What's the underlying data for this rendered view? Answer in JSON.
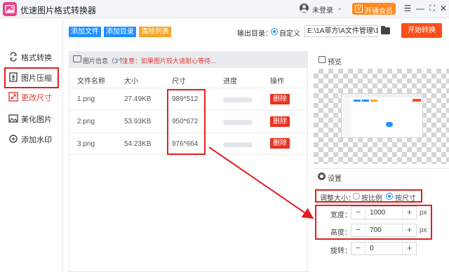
{
  "app": {
    "title": "优速图片格式转换器"
  },
  "titlebar": {
    "login_text": "未登录",
    "vip_label": "开通会员"
  },
  "sidebar": {
    "items": [
      {
        "label": "格式转换",
        "icon": "format-convert-icon"
      },
      {
        "label": "图片压缩",
        "icon": "image-compress-icon"
      },
      {
        "label": "更改尺寸",
        "icon": "resize-icon",
        "active": true
      },
      {
        "label": "美化图片",
        "icon": "beautify-icon"
      },
      {
        "label": "添加水印",
        "icon": "watermark-icon"
      }
    ]
  },
  "toolbar": {
    "add_file": "添加文件",
    "add_dir": "添加目录",
    "clear_list": "清除列表",
    "output_dir_label": "输出目录：",
    "custom_label": "自定义",
    "output_path": "E:\\1A菲方\\A文件管理\\1",
    "start_label": "开始转换"
  },
  "file_panel": {
    "info_label": "图片信息（3个）",
    "notice": "注意：如果图片较大请耐心等待...",
    "columns": [
      "文件名称",
      "大小",
      "尺寸",
      "进度",
      "操作"
    ],
    "rows": [
      {
        "name": "1.png",
        "size": "27.49KB",
        "dims": "989*512",
        "progress": 0,
        "action": "删除"
      },
      {
        "name": "2.png",
        "size": "53.93KB",
        "dims": "950*672",
        "progress": 0,
        "action": "删除"
      },
      {
        "name": "3.png",
        "size": "54.23KB",
        "dims": "976*664",
        "progress": 0,
        "action": "删除"
      }
    ]
  },
  "preview": {
    "label": "预览"
  },
  "settings": {
    "label": "设置",
    "adjust_label": "调整大小：",
    "options": [
      {
        "label": "按比例",
        "selected": false
      },
      {
        "label": "按尺寸",
        "selected": true
      }
    ],
    "width_label": "宽度：",
    "width_value": "1000",
    "height_label": "高度：",
    "height_value": "700",
    "rotate_label": "旋转：",
    "rotate_value": "0",
    "unit": "px"
  },
  "colors": {
    "accent_blue": "#1e90ff",
    "start_red": "#ff4d1a",
    "highlight_red": "#e02020",
    "vip_orange": "#ff8a1f"
  }
}
